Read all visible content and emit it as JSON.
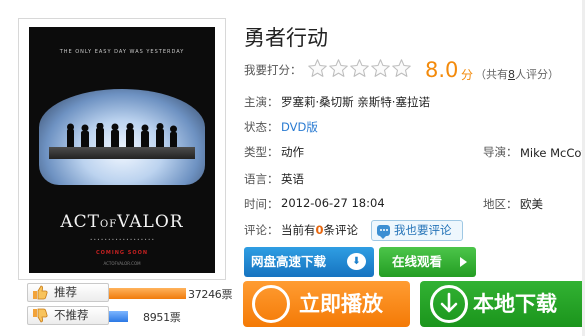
{
  "movie": {
    "title": "勇者行动",
    "poster": {
      "tagline": "THE ONLY EASY DAY WAS YESTERDAY",
      "title_act": "ACT",
      "title_of": "OF",
      "title_valor": "VALOR",
      "coming_soon": "COMING SOON",
      "site": "ACTOFVALOR.COM"
    }
  },
  "rating": {
    "label": "我要打分：",
    "stars_total": 5,
    "stars_filled": 0,
    "score": "8.0",
    "score_unit": "分",
    "raters_prefix": "（共有",
    "raters_count": "8",
    "raters_suffix": "人评分）"
  },
  "details": {
    "cast_label": "主演：",
    "cast_value": "罗塞莉·桑切斯  亲斯特·塞拉诺",
    "status_label": "状态：",
    "status_value": "DVD版",
    "genre_label": "类型：",
    "genre_value": "动作",
    "director_label": "导演：",
    "director_value": "Mike  McCoy",
    "language_label": "语言：",
    "language_value": "英语",
    "time_label": "时间：",
    "time_value": "2012-06-27 18:04",
    "region_label": "地区：",
    "region_value": "欧美",
    "comment_label": "评论：",
    "comment_prefix": "当前有",
    "comment_count": "0",
    "comment_suffix": "条评论",
    "comment_button": "我也要评论"
  },
  "votes": {
    "up_label": "推荐",
    "up_count": "37246票",
    "up_fraction": 0.7,
    "down_label": "不推荐",
    "down_count": "8951票",
    "down_fraction": 0.17
  },
  "actions": {
    "pan_download": "网盘高速下载",
    "online_watch": "在线观看",
    "play_now": "立即播放",
    "local_download": "本地下载"
  },
  "colors": {
    "accent_orange": "#f38a0b",
    "blue": "#1c80cb",
    "green": "#249d23"
  }
}
